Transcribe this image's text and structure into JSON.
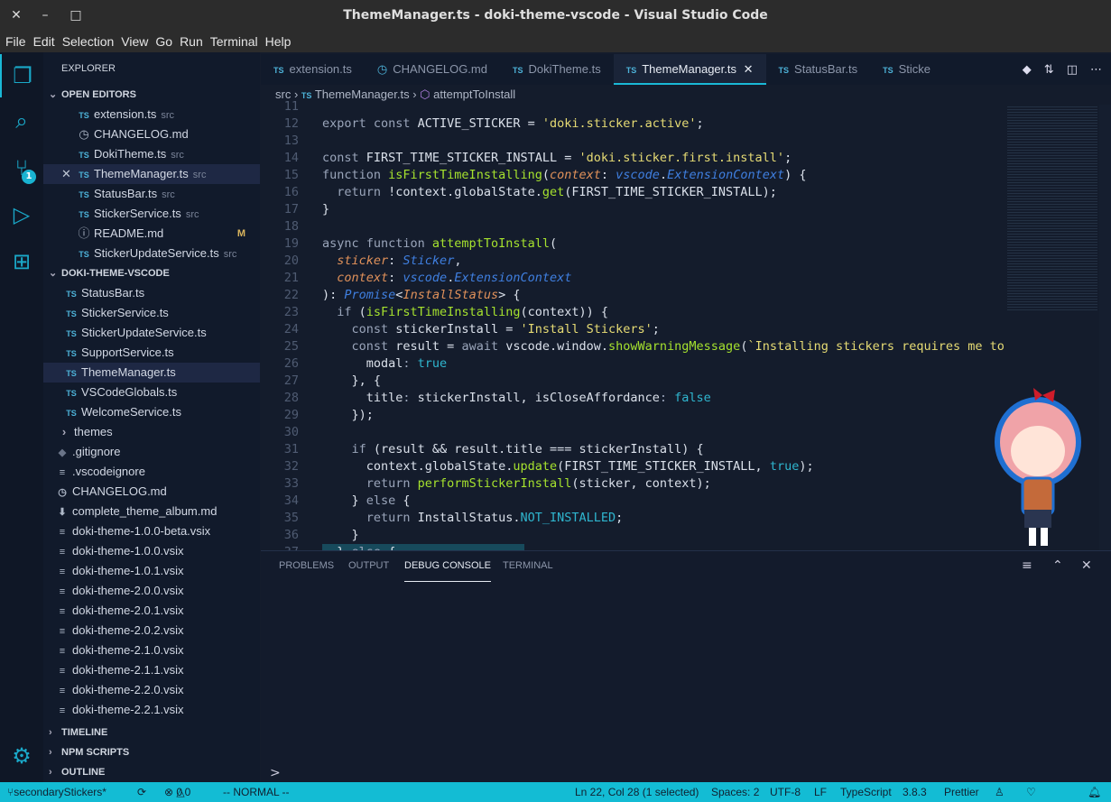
{
  "window": {
    "title": "ThemeManager.ts - doki-theme-vscode - Visual Studio Code"
  },
  "menu": [
    "File",
    "Edit",
    "Selection",
    "View",
    "Go",
    "Run",
    "Terminal",
    "Help"
  ],
  "sidebar": {
    "title": "EXPLORER",
    "open_editors_label": "OPEN EDITORS",
    "open_editors": [
      {
        "icon": "TS",
        "name": "extension.ts",
        "desc": "src"
      },
      {
        "icon": "clock",
        "name": "CHANGELOG.md",
        "desc": ""
      },
      {
        "icon": "TS",
        "name": "DokiTheme.ts",
        "desc": "src"
      },
      {
        "icon": "TS",
        "name": "ThemeManager.ts",
        "desc": "src"
      },
      {
        "icon": "TS",
        "name": "StatusBar.ts",
        "desc": "src"
      },
      {
        "icon": "TS",
        "name": "StickerService.ts",
        "desc": "src"
      },
      {
        "icon": "info",
        "name": "README.md",
        "desc": "",
        "badge": "M"
      },
      {
        "icon": "TS",
        "name": "StickerUpdateService.ts",
        "desc": "src"
      }
    ],
    "project_label": "DOKI-THEME-VSCODE",
    "src_files": [
      "StatusBar.ts",
      "StickerService.ts",
      "StickerUpdateService.ts",
      "SupportService.ts",
      "ThemeManager.ts",
      "VSCodeGlobals.ts",
      "WelcomeService.ts"
    ],
    "folder": "themes",
    "root_files": [
      ".gitignore",
      ".vscodeignore",
      "CHANGELOG.md",
      "complete_theme_album.md",
      "doki-theme-1.0.0-beta.vsix",
      "doki-theme-1.0.0.vsix",
      "doki-theme-1.0.1.vsix",
      "doki-theme-2.0.0.vsix",
      "doki-theme-2.0.1.vsix",
      "doki-theme-2.0.2.vsix",
      "doki-theme-2.1.0.vsix",
      "doki-theme-2.1.1.vsix",
      "doki-theme-2.2.0.vsix",
      "doki-theme-2.2.1.vsix"
    ],
    "bottom_sections": [
      "TIMELINE",
      "NPM SCRIPTS",
      "OUTLINE"
    ]
  },
  "activity": {
    "scm_badge": "1"
  },
  "tabs": [
    {
      "icon": "TS",
      "label": "extension.ts"
    },
    {
      "icon": "clock",
      "label": "CHANGELOG.md"
    },
    {
      "icon": "TS",
      "label": "DokiTheme.ts"
    },
    {
      "icon": "TS",
      "label": "ThemeManager.ts",
      "active": true
    },
    {
      "icon": "TS",
      "label": "StatusBar.ts"
    },
    {
      "icon": "TS",
      "label": "Sticke"
    }
  ],
  "breadcrumb": {
    "folder": "src",
    "file": "ThemeManager.ts",
    "symbol": "attemptToInstall"
  },
  "code": [
    {
      "n": "11",
      "t": []
    },
    {
      "n": "12",
      "t": [
        [
          "export const ",
          "kw"
        ],
        [
          "ACTIVE_STICKER = ",
          "pl"
        ],
        [
          "'doki.sticker.active'",
          "str"
        ],
        [
          ";",
          "pl"
        ]
      ]
    },
    {
      "n": "13",
      "t": []
    },
    {
      "n": "14",
      "t": [
        [
          "const ",
          "kw"
        ],
        [
          "FIRST_TIME_STICKER_INSTALL = ",
          "pl"
        ],
        [
          "'doki.sticker.first.install'",
          "str"
        ],
        [
          ";",
          "pl"
        ]
      ]
    },
    {
      "n": "15",
      "t": [
        [
          "function ",
          "kw"
        ],
        [
          "isFirstTimeInstalling",
          "fn"
        ],
        [
          "(",
          "pl"
        ],
        [
          "context",
          "par"
        ],
        [
          ": ",
          "pl"
        ],
        [
          "vscode",
          "ty"
        ],
        [
          ".",
          "pl"
        ],
        [
          "ExtensionContext",
          "ty"
        ],
        [
          ") {",
          "pl"
        ]
      ]
    },
    {
      "n": "16",
      "t": [
        [
          "  return ",
          "kw"
        ],
        [
          "!context.globalState.",
          "pl"
        ],
        [
          "get",
          "fn"
        ],
        [
          "(FIRST_TIME_STICKER_INSTALL);",
          "pl"
        ]
      ]
    },
    {
      "n": "17",
      "t": [
        [
          "}",
          "pl"
        ]
      ]
    },
    {
      "n": "18",
      "t": []
    },
    {
      "n": "19",
      "t": [
        [
          "async function ",
          "kw"
        ],
        [
          "attemptToInstall",
          "fn"
        ],
        [
          "(",
          "pl"
        ]
      ]
    },
    {
      "n": "20",
      "t": [
        [
          "  sticker",
          "par"
        ],
        [
          ": ",
          "pl"
        ],
        [
          "Sticker",
          "ty"
        ],
        [
          ",",
          "pl"
        ]
      ]
    },
    {
      "n": "21",
      "t": [
        [
          "  context",
          "par"
        ],
        [
          ": ",
          "pl"
        ],
        [
          "vscode",
          "ty"
        ],
        [
          ".",
          "pl"
        ],
        [
          "ExtensionContext",
          "ty"
        ]
      ]
    },
    {
      "n": "22",
      "t": [
        [
          "): ",
          "pl"
        ],
        [
          "Promise",
          "ty"
        ],
        [
          "<",
          "pl"
        ],
        [
          "InstallStatus",
          "par"
        ],
        [
          "> {",
          "pl"
        ]
      ]
    },
    {
      "n": "23",
      "t": [
        [
          "  if ",
          "kw"
        ],
        [
          "(",
          "pl"
        ],
        [
          "isFirstTimeInstalling",
          "fn"
        ],
        [
          "(context)) {",
          "pl"
        ]
      ]
    },
    {
      "n": "24",
      "t": [
        [
          "    const ",
          "kw"
        ],
        [
          "stickerInstall = ",
          "pl"
        ],
        [
          "'Install Stickers'",
          "str"
        ],
        [
          ";",
          "pl"
        ]
      ]
    },
    {
      "n": "25",
      "t": [
        [
          "    const ",
          "kw"
        ],
        [
          "result = ",
          "pl"
        ],
        [
          "await ",
          "kw"
        ],
        [
          "vscode.window.",
          "pl"
        ],
        [
          "showWarningMessage",
          "fn"
        ],
        [
          "(",
          "pl"
        ],
        [
          "`Installing stickers requires me to corru",
          "str"
        ]
      ]
    },
    {
      "n": "26",
      "t": [
        [
          "      modal",
          "pl"
        ],
        [
          ": ",
          "kw"
        ],
        [
          "true",
          "con"
        ]
      ]
    },
    {
      "n": "27",
      "t": [
        [
          "    }, {",
          "pl"
        ]
      ]
    },
    {
      "n": "28",
      "t": [
        [
          "      title",
          "pl"
        ],
        [
          ": ",
          "kw"
        ],
        [
          "stickerInstall, isCloseAffordance",
          "pl"
        ],
        [
          ": ",
          "kw"
        ],
        [
          "false",
          "con"
        ]
      ]
    },
    {
      "n": "29",
      "t": [
        [
          "    });",
          "pl"
        ]
      ]
    },
    {
      "n": "30",
      "t": []
    },
    {
      "n": "31",
      "t": [
        [
          "    if ",
          "kw"
        ],
        [
          "(result && result.title === stickerInstall) {",
          "pl"
        ]
      ]
    },
    {
      "n": "32",
      "t": [
        [
          "      context.globalState.",
          "pl"
        ],
        [
          "update",
          "fn"
        ],
        [
          "(FIRST_TIME_STICKER_INSTALL, ",
          "pl"
        ],
        [
          "true",
          "con"
        ],
        [
          ");",
          "pl"
        ]
      ]
    },
    {
      "n": "33",
      "t": [
        [
          "      return ",
          "kw"
        ],
        [
          "performStickerInstall",
          "fn"
        ],
        [
          "(sticker, context);",
          "pl"
        ]
      ]
    },
    {
      "n": "34",
      "t": [
        [
          "    } ",
          "pl"
        ],
        [
          "else ",
          "kw"
        ],
        [
          "{",
          "pl"
        ]
      ]
    },
    {
      "n": "35",
      "t": [
        [
          "      return ",
          "kw"
        ],
        [
          "InstallStatus.",
          "pl"
        ],
        [
          "NOT_INSTALLED",
          "con"
        ],
        [
          ";",
          "pl"
        ]
      ]
    },
    {
      "n": "36",
      "t": [
        [
          "    }",
          "pl"
        ]
      ]
    },
    {
      "n": "37",
      "t": [
        [
          "  } ",
          "pl"
        ],
        [
          "else ",
          "kw"
        ],
        [
          "{",
          "pl"
        ]
      ]
    }
  ],
  "panel": {
    "tabs": [
      "PROBLEMS",
      "OUTPUT",
      "DEBUG CONSOLE",
      "TERMINAL"
    ],
    "active": "DEBUG CONSOLE",
    "prompt": ">"
  },
  "status": {
    "branch": "secondaryStickers*",
    "errors": "0",
    "warnings": "0",
    "mode": "-- NORMAL --",
    "position": "Ln 22, Col 28 (1 selected)",
    "spaces": "Spaces: 2",
    "encoding": "UTF-8",
    "eol": "LF",
    "language": "TypeScript",
    "ts_version": "3.8.3",
    "formatter": "Prettier"
  },
  "colors": {
    "accent": "#13bcd4",
    "editor_bg": "#141c2c",
    "sidebar_bg": "#111a2b"
  }
}
